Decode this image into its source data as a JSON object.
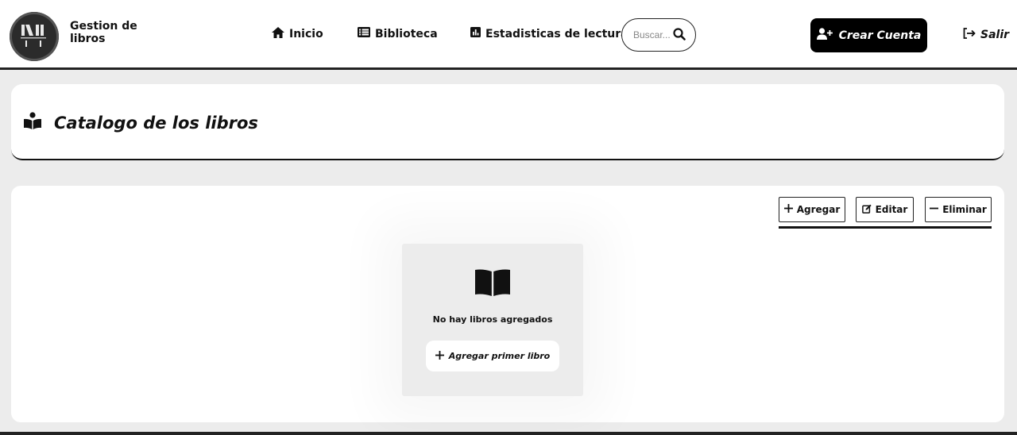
{
  "header": {
    "brand_title": "Gestion de libros",
    "logo_icon": "library-logo-icon",
    "nav": [
      {
        "label": "Inicio",
        "icon": "home-icon"
      },
      {
        "label": "Biblioteca",
        "icon": "list-icon"
      },
      {
        "label": "Estadisticas de lectura",
        "icon": "chart-icon"
      }
    ],
    "search": {
      "placeholder": "Buscar...",
      "icon": "search-icon"
    },
    "create_account_label": "Crear Cuenta",
    "logout_label": "Salir"
  },
  "page": {
    "title": "Catalogo de los libros",
    "title_icon": "book-reader-icon"
  },
  "toolbar": {
    "add_label": "Agregar",
    "edit_label": "Editar",
    "delete_label": "Eliminar"
  },
  "empty_state": {
    "icon": "open-book-icon",
    "message": "No hay libros agregados",
    "add_first_label": "Agregar primer libro"
  }
}
